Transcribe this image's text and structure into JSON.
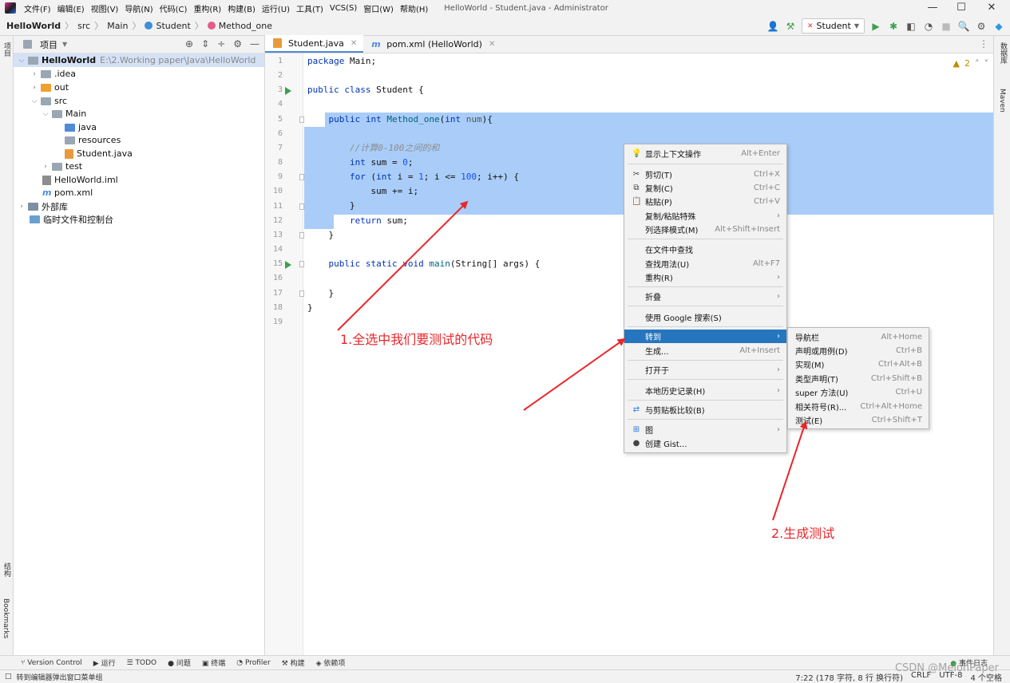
{
  "menubar": {
    "items": [
      "文件(F)",
      "编辑(E)",
      "视图(V)",
      "导航(N)",
      "代码(C)",
      "重构(R)",
      "构建(B)",
      "运行(U)",
      "工具(T)",
      "VCS(S)",
      "窗口(W)",
      "帮助(H)"
    ],
    "window_title": "HelloWorld - Student.java - Administrator",
    "minimize": "—",
    "maximize": "☐",
    "close": "✕"
  },
  "breadcrumb": {
    "project": "HelloWorld",
    "src": "src",
    "pkg": "Main",
    "cls": "Student",
    "method": "Method_one"
  },
  "toolbar": {
    "run_config": "Student"
  },
  "left_strip": {
    "project": "项目",
    "structure": "结构",
    "bookmarks": "Bookmarks"
  },
  "project_panel": {
    "title": "项目",
    "root_name": "HelloWorld",
    "root_path": "E:\\2.Working paper\\Java\\HelloWorld",
    "idea": ".idea",
    "out": "out",
    "src": "src",
    "main": "Main",
    "java": "java",
    "resources": "resources",
    "student": "Student.java",
    "test": "test",
    "iml": "HelloWorld.iml",
    "pom": "pom.xml",
    "ext_libs": "外部库",
    "scratches": "临时文件和控制台"
  },
  "tabs": [
    {
      "label": "Student.java"
    },
    {
      "label": "pom.xml (HelloWorld)"
    }
  ],
  "editor": {
    "line_numbers": [
      "1",
      "2",
      "3",
      "4",
      "5",
      "6",
      "7",
      "8",
      "9",
      "10",
      "11",
      "12",
      "13",
      "14",
      "15",
      "16",
      "17",
      "18",
      "19"
    ],
    "warnings": "2"
  },
  "code": {
    "l1_kw": "package",
    "l1_rest": " Main;",
    "l3_kw": "public class",
    "l3_rest": " Student {",
    "l5_kw": "    public int",
    "l5_fn": " Method_one",
    "l5_p1": "(",
    "l5_kw2": "int",
    "l5_pm": " num",
    "l5_end": "){",
    "l7_cmt": "        //计算0-100之间的和",
    "l8_kw": "        int",
    "l8_mid": " sum = ",
    "l8_num": "0",
    "l8_end": ";",
    "l9_kw": "        for",
    "l9_a": " (",
    "l9_kw2": "int",
    "l9_b": " i = ",
    "l9_n1": "1",
    "l9_c": "; i <= ",
    "l9_n2": "100",
    "l9_d": "; i++) {",
    "l10": "            sum += i;",
    "l11": "        }",
    "l12_kw": "        return",
    "l12_rest": " sum;",
    "l13": "    }",
    "l15_kw": "    public static void",
    "l15_fn": " main",
    "l15_rest": "(String[] args) {",
    "l17": "    }",
    "l18": "}"
  },
  "context_menu": {
    "items": [
      {
        "label": "显示上下文操作",
        "shortcut": "Alt+Enter",
        "icon": "bulb-icon"
      },
      {
        "label": "剪切(T)",
        "shortcut": "Ctrl+X",
        "icon": "scissors-icon"
      },
      {
        "label": "复制(C)",
        "shortcut": "Ctrl+C",
        "icon": "copy-icon"
      },
      {
        "label": "粘贴(P)",
        "shortcut": "Ctrl+V",
        "icon": "paste-icon"
      },
      {
        "label": "复制/粘贴特殊",
        "shortcut": ""
      },
      {
        "label": "列选择模式(M)",
        "shortcut": "Alt+Shift+Insert"
      },
      {
        "label": "在文件中查找",
        "shortcut": ""
      },
      {
        "label": "查找用法(U)",
        "shortcut": "Alt+F7"
      },
      {
        "label": "重构(R)",
        "shortcut": ""
      },
      {
        "label": "折叠",
        "shortcut": ""
      },
      {
        "label": "使用 Google 搜索(S)",
        "shortcut": ""
      },
      {
        "label": "转到",
        "shortcut": ""
      },
      {
        "label": "生成...",
        "shortcut": "Alt+Insert"
      },
      {
        "label": "打开于",
        "shortcut": ""
      },
      {
        "label": "本地历史记录(H)",
        "shortcut": ""
      },
      {
        "label": "与剪贴板比较(B)",
        "shortcut": "",
        "icon": "compare-icon"
      },
      {
        "label": "图",
        "shortcut": "",
        "icon": "diagram-icon"
      },
      {
        "label": "创建 Gist...",
        "shortcut": "",
        "icon": "github-icon"
      }
    ]
  },
  "submenu": {
    "items": [
      {
        "label": "导航栏",
        "shortcut": "Alt+Home"
      },
      {
        "label": "声明或用例(D)",
        "shortcut": "Ctrl+B"
      },
      {
        "label": "实现(M)",
        "shortcut": "Ctrl+Alt+B"
      },
      {
        "label": "类型声明(T)",
        "shortcut": "Ctrl+Shift+B"
      },
      {
        "label": "super 方法(U)",
        "shortcut": "Ctrl+U"
      },
      {
        "label": "相关符号(R)...",
        "shortcut": "Ctrl+Alt+Home"
      },
      {
        "label": "测试(E)",
        "shortcut": "Ctrl+Shift+T"
      }
    ]
  },
  "annotations": {
    "step1": "1.全选中我们要测试的代码",
    "step2": "2.生成测试",
    "color": "#e8272b"
  },
  "right_strip": {
    "database": "数据库",
    "maven": "Maven"
  },
  "bottom_tools": {
    "version_control": "Version Control",
    "run": "运行",
    "todo": "TODO",
    "problems": "问题",
    "terminal": "终端",
    "profiler": "Profiler",
    "build": "构建",
    "deps": "依赖项",
    "event_log": "事件日志"
  },
  "status": {
    "message": "转到编辑器弹出窗口菜单组",
    "position": "7:22 (178 字符, 8 行 换行符)",
    "line_sep": "CRLF",
    "encoding": "UTF-8",
    "indent": "4 个空格"
  },
  "watermark": "CSDN @MelonPaper"
}
